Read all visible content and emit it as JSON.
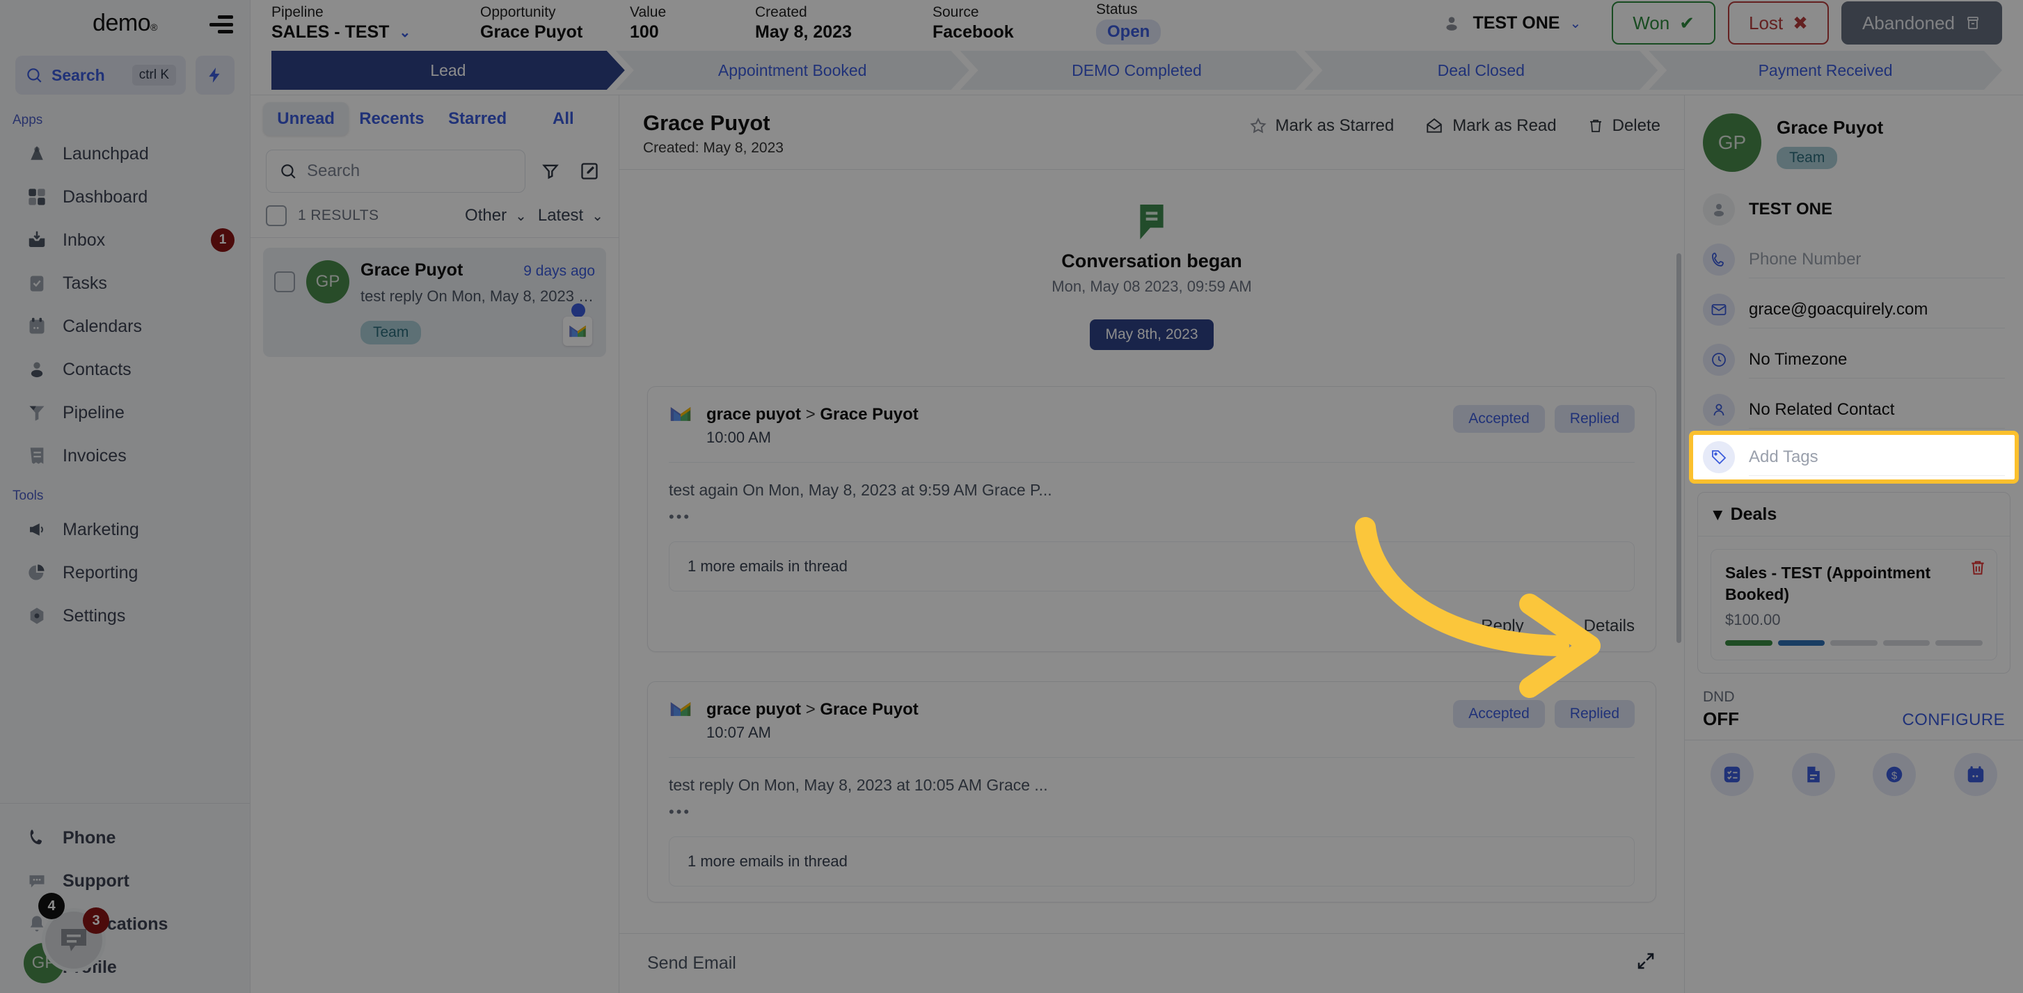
{
  "nav": {
    "brand": "demo",
    "search": {
      "label": "Search",
      "shortcut": "ctrl K"
    },
    "sections": [
      {
        "title": "Apps",
        "items": [
          {
            "label": "Launchpad",
            "icon": "launchpad-icon",
            "badge": ""
          },
          {
            "label": "Dashboard",
            "icon": "dashboard-icon",
            "badge": ""
          },
          {
            "label": "Inbox",
            "icon": "inbox-icon",
            "badge": "1"
          },
          {
            "label": "Tasks",
            "icon": "tasks-icon",
            "badge": ""
          },
          {
            "label": "Calendars",
            "icon": "calendar-icon",
            "badge": ""
          },
          {
            "label": "Contacts",
            "icon": "contacts-icon",
            "badge": ""
          },
          {
            "label": "Pipeline",
            "icon": "pipeline-icon",
            "badge": ""
          },
          {
            "label": "Invoices",
            "icon": "invoices-icon",
            "badge": ""
          }
        ]
      },
      {
        "title": "Tools",
        "items": [
          {
            "label": "Marketing",
            "icon": "megaphone-icon",
            "badge": ""
          },
          {
            "label": "Reporting",
            "icon": "piechart-icon",
            "badge": ""
          },
          {
            "label": "Settings",
            "icon": "gear-icon",
            "badge": ""
          }
        ]
      }
    ],
    "bottom": [
      {
        "label": "Phone",
        "icon": "phone-icon",
        "badge": ""
      },
      {
        "label": "Support",
        "icon": "support-chat-icon",
        "badge": ""
      },
      {
        "label": "Notifications",
        "icon": "bell-icon",
        "badge": ""
      },
      {
        "label": "Profile",
        "icon": "avatar-icon",
        "badge": ""
      }
    ],
    "chat_widget": {
      "badge": "3",
      "dark_badge": "4",
      "avatar_initials": "GP"
    }
  },
  "opportunity_bar": {
    "fields": [
      {
        "key": "Pipeline",
        "value": "SALES - TEST",
        "dropdown": true
      },
      {
        "key": "Opportunity",
        "value": "Grace Puyot",
        "dropdown": false
      },
      {
        "key": "Value",
        "value": "100",
        "dropdown": false
      },
      {
        "key": "Created",
        "value": "May 8, 2023",
        "dropdown": false
      },
      {
        "key": "Source",
        "value": "Facebook",
        "dropdown": false
      },
      {
        "key": "Status",
        "value": "Open",
        "dropdown": false
      }
    ],
    "owner": "TEST ONE",
    "buttons": {
      "won": "Won",
      "lost": "Lost",
      "abandoned": "Abandoned"
    }
  },
  "stages": [
    {
      "label": "Lead",
      "active": true
    },
    {
      "label": "Appointment Booked",
      "active": false
    },
    {
      "label": "DEMO Completed",
      "active": false
    },
    {
      "label": "Deal Closed",
      "active": false
    },
    {
      "label": "Payment Received",
      "active": false
    }
  ],
  "conversation_list": {
    "tabs": [
      {
        "label": "Unread",
        "active": true
      },
      {
        "label": "Recents",
        "active": false
      },
      {
        "label": "Starred",
        "active": false
      },
      {
        "label": "All",
        "active": false
      }
    ],
    "search_placeholder": "Search",
    "results_count": "1 RESULTS",
    "filter_label": "Other",
    "sort_label": "Latest",
    "rows": [
      {
        "initials": "GP",
        "name": "Grace Puyot",
        "time": "9 days ago",
        "preview": "test reply On Mon, May 8, 2023 at ...",
        "tag": "Team",
        "channel": "gmail-icon"
      }
    ]
  },
  "conversation": {
    "title": "Grace Puyot",
    "created": "Created: May 8, 2023",
    "actions": [
      {
        "label": "Mark as Starred",
        "icon": "star-icon"
      },
      {
        "label": "Mark as Read",
        "icon": "envelope-open-icon"
      },
      {
        "label": "Delete",
        "icon": "trash-icon"
      }
    ],
    "began_title": "Conversation began",
    "began_sub": "Mon, May 08 2023, 09:59 AM",
    "date_chip": "May 8th, 2023",
    "messages": [
      {
        "from": "grace puyot",
        "to": "Grace Puyot",
        "time": "10:00 AM",
        "chips": [
          "Accepted",
          "Replied"
        ],
        "body": "test again On Mon, May 8, 2023 at 9:59 AM Grace P...",
        "thread_note": "1 more emails in thread",
        "footer": [
          {
            "label": "Reply",
            "icon": "reply-icon"
          },
          {
            "label": "Details",
            "icon": "info-icon"
          }
        ]
      },
      {
        "from": "grace puyot",
        "to": "Grace Puyot",
        "time": "10:07 AM",
        "chips": [
          "Accepted",
          "Replied"
        ],
        "body": "test reply On Mon, May 8, 2023 at 10:05 AM Grace ...",
        "thread_note": "1 more emails in thread",
        "footer": []
      }
    ],
    "send_placeholder": "Send Email"
  },
  "contact_panel": {
    "initials": "GP",
    "name": "Grace Puyot",
    "tag": "Team",
    "owner": "TEST ONE",
    "phone_placeholder": "Phone Number",
    "email": "grace@goacquirely.com",
    "timezone": "No Timezone",
    "related_contact": "No Related Contact",
    "tags_placeholder": "Add Tags",
    "deals_header": "Deals",
    "deal": {
      "name": "Sales - TEST (Appointment Booked)",
      "amount": "$100.00",
      "progress_colors": [
        "#3a8a43",
        "#2f6fb5",
        "#d5d8dd",
        "#d5d8dd",
        "#d5d8dd"
      ]
    },
    "dnd_label": "DND",
    "dnd_value": "OFF",
    "configure": "CONFIGURE",
    "quick_actions": [
      {
        "icon": "task-list-icon"
      },
      {
        "icon": "document-icon"
      },
      {
        "icon": "dollar-icon"
      },
      {
        "icon": "calendar-icon"
      }
    ]
  },
  "annotation": {
    "arrow_color": "#FBC63B",
    "highlight_color": "#FBC02D",
    "target": "Add Tags"
  }
}
